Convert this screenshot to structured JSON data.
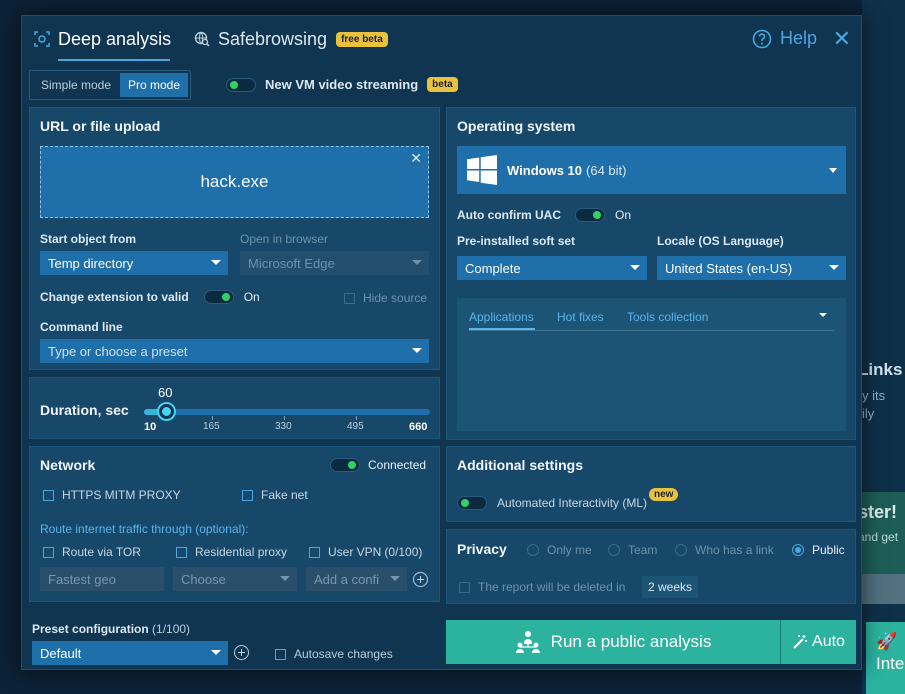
{
  "header": {
    "tab_deep": "Deep analysis",
    "tab_safe": "Safebrowsing",
    "safe_badge": "free beta",
    "help": "Help"
  },
  "modes": {
    "simple": "Simple mode",
    "pro": "Pro mode",
    "active": "Pro mode"
  },
  "vm_streaming": {
    "label": "New VM video streaming",
    "badge": "beta",
    "enabled": false
  },
  "upload": {
    "title": "URL or file upload",
    "file_name": "hack.exe",
    "start_object_label": "Start object from",
    "start_object_value": "Temp directory",
    "open_browser_label": "Open in browser",
    "open_browser_value": "Microsoft Edge",
    "change_ext_label": "Change extension to valid",
    "change_ext_state": "On",
    "hide_source": "Hide source",
    "command_line_label": "Command line",
    "command_line_placeholder": "Type or choose a preset"
  },
  "duration": {
    "label": "Duration, sec",
    "value": "60",
    "ticks": [
      "10",
      "165",
      "330",
      "495",
      "660"
    ]
  },
  "network": {
    "title": "Network",
    "status": "Connected",
    "https_mitm": "HTTPS MITM PROXY",
    "fake_net": "Fake net",
    "route_label": "Route internet traffic through (optional):",
    "tor": "Route via TOR",
    "residential": "Residential proxy",
    "user_vpn": "User VPN",
    "user_vpn_count": "(0/100)",
    "geo_placeholder": "Fastest geo",
    "choose_placeholder": "Choose",
    "config_placeholder": "Add a confi"
  },
  "os": {
    "title": "Operating system",
    "name": "Windows 10",
    "bits": "(64 bit)",
    "uac_label": "Auto confirm UAC",
    "uac_state": "On",
    "soft_set_label": "Pre-installed soft set",
    "soft_set_value": "Complete",
    "locale_label": "Locale (OS Language)",
    "locale_value": "United States (en-US)",
    "tabs": [
      "Applications",
      "Hot fixes",
      "Tools collection"
    ]
  },
  "additional": {
    "title": "Additional settings",
    "automated": "Automated Interactivity (ML)",
    "new_badge": "new"
  },
  "privacy": {
    "title": "Privacy",
    "options": [
      "Only me",
      "Team",
      "Who has a link",
      "Public"
    ],
    "selected": "Public",
    "delete_label": "The report will be deleted in",
    "delete_value": "2 weeks"
  },
  "preset": {
    "label": "Preset configuration",
    "count": "(1/100)",
    "value": "Default",
    "autosave": "Autosave changes"
  },
  "actions": {
    "run": "Run a public analysis",
    "auto": "Auto"
  },
  "background": {
    "links": "Links",
    "sub1": "y its",
    "sub2": "ily",
    "ster": "ster!",
    "andget": "and get",
    "tile_text": "Inte"
  },
  "colors": {
    "accent": "#1e6faa",
    "run": "#2bb3a0",
    "badge": "#e9c23d",
    "toggle_on": "#2fd16a"
  }
}
